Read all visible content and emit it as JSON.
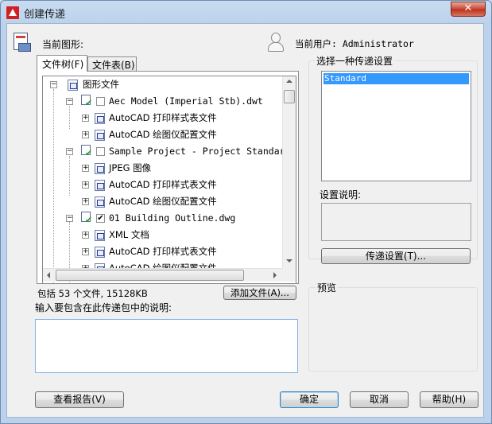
{
  "window": {
    "title": "创建传递",
    "close_label": "✕"
  },
  "header": {
    "current_drawing_label": "当前图形:",
    "current_user_label": "当前用户: Administrator"
  },
  "tabs": [
    {
      "label": "文件树(F)"
    },
    {
      "label": "文件表(B)"
    }
  ],
  "tree": {
    "root": "图形文件",
    "items": [
      {
        "label": "Aec Model (Imperial Stb).dwt"
      },
      {
        "label": "AutoCAD 打印样式表文件"
      },
      {
        "label": "AutoCAD 绘图仪配置文件"
      },
      {
        "label": "Sample Project - Project Standards.dwg"
      },
      {
        "label": "JPEG 图像"
      },
      {
        "label": "AutoCAD 打印样式表文件"
      },
      {
        "label": "AutoCAD 绘图仪配置文件"
      },
      {
        "label": "01 Building Outline.dwg"
      },
      {
        "label": "XML 文档"
      },
      {
        "label": "AutoCAD 打印样式表文件"
      },
      {
        "label": "AutoCAD 绘图仪配置文件"
      }
    ]
  },
  "summary": {
    "text": "包括 53 个文件, 15128KB",
    "add_file_label": "添加文件(A)..."
  },
  "notes": {
    "label": "输入要包含在此传递包中的说明:",
    "value": ""
  },
  "transmittal": {
    "group_label": "选择一种传递设置",
    "selected": "Standard",
    "desc_label": "设置说明:",
    "setup_button": "传递设置(T)..."
  },
  "preview": {
    "label": "预览"
  },
  "footer": {
    "view_report": "查看报告(V)",
    "ok": "确定",
    "cancel": "取消",
    "help": "帮助(H)"
  },
  "colors": {
    "selection": "#3399ff",
    "title_close": "#c94634",
    "checkmark": "#1f9a2a"
  }
}
